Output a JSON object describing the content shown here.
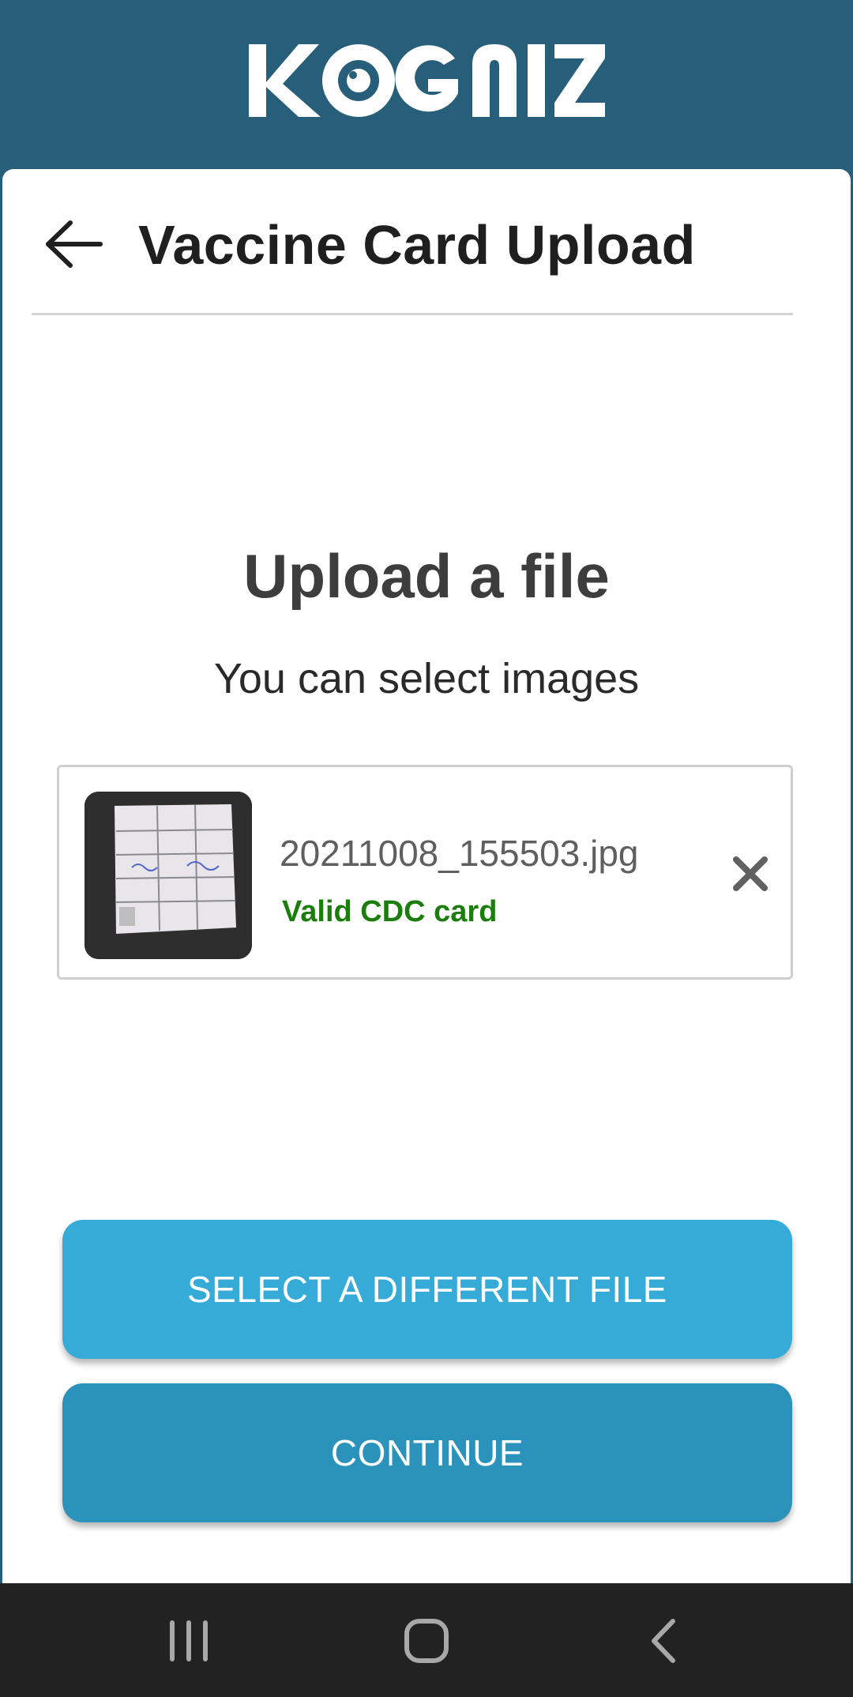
{
  "brand": {
    "logo_text": "KOGNIZ",
    "color": "#275f7b"
  },
  "header": {
    "title": "Vaccine Card Upload",
    "back_icon": "arrow-left-icon"
  },
  "upload": {
    "heading": "Upload a file",
    "subheading": "You can select images",
    "file": {
      "name": "20211008_155503.jpg",
      "status": "Valid CDC card",
      "status_color": "#1a7d0c",
      "remove_icon": "close-icon"
    }
  },
  "actions": {
    "select_label": "SELECT A DIFFERENT FILE",
    "continue_label": "CONTINUE",
    "select_color": "#36abd8",
    "continue_color": "#2a92bb"
  },
  "system_nav": {
    "recents_icon": "recents-icon",
    "home_icon": "home-icon",
    "back_icon": "back-chevron-icon"
  }
}
